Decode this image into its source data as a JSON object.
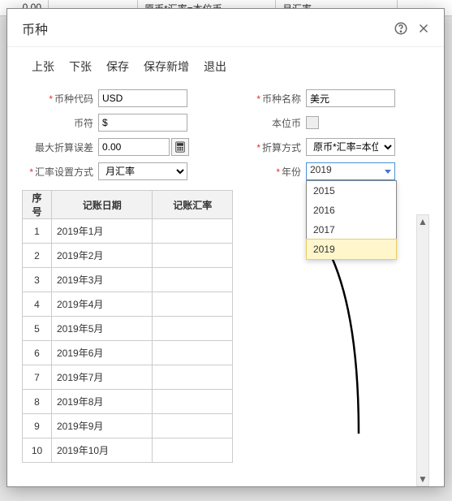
{
  "bg": {
    "c1": "0.00",
    "c2": "原币*汇率=本位币",
    "c3": "月汇率"
  },
  "dialog": {
    "title": "币种",
    "toolbar": [
      "上张",
      "下张",
      "保存",
      "保存新增",
      "退出"
    ]
  },
  "form": {
    "code_label": "币种代码",
    "code_value": "USD",
    "name_label": "币种名称",
    "name_value": "美元",
    "symbol_label": "币符",
    "symbol_value": "$",
    "base_label": "本位币",
    "base_checked": false,
    "max_err_label": "最大折算误差",
    "max_err_value": "0.00",
    "conv_label": "折算方式",
    "conv_value": "原币*汇率=本位币",
    "rate_mode_label": "汇率设置方式",
    "rate_mode_value": "月汇率",
    "year_label": "年份",
    "year_value": "2019",
    "year_options": [
      "2015",
      "2016",
      "2017",
      "2019"
    ],
    "year_highlight": "2019"
  },
  "table": {
    "headers": [
      "序号",
      "记账日期",
      "记账汇率"
    ],
    "rows": [
      {
        "idx": "1",
        "date": "2019年1月",
        "rate": ""
      },
      {
        "idx": "2",
        "date": "2019年2月",
        "rate": ""
      },
      {
        "idx": "3",
        "date": "2019年3月",
        "rate": ""
      },
      {
        "idx": "4",
        "date": "2019年4月",
        "rate": ""
      },
      {
        "idx": "5",
        "date": "2019年5月",
        "rate": ""
      },
      {
        "idx": "6",
        "date": "2019年6月",
        "rate": ""
      },
      {
        "idx": "7",
        "date": "2019年7月",
        "rate": ""
      },
      {
        "idx": "8",
        "date": "2019年8月",
        "rate": ""
      },
      {
        "idx": "9",
        "date": "2019年9月",
        "rate": ""
      },
      {
        "idx": "10",
        "date": "2019年10月",
        "rate": ""
      }
    ]
  }
}
